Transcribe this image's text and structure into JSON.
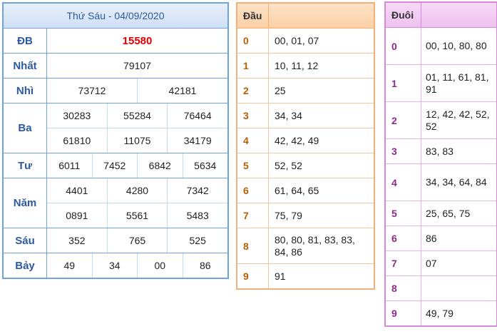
{
  "results": {
    "title": "Thứ Sáu - 04/09/2020",
    "prizes": [
      {
        "label": "ĐB",
        "lines": [
          [
            "15580"
          ]
        ]
      },
      {
        "label": "Nhất",
        "lines": [
          [
            "79107"
          ]
        ]
      },
      {
        "label": "Nhì",
        "lines": [
          [
            "73712",
            "42181"
          ]
        ]
      },
      {
        "label": "Ba",
        "lines": [
          [
            "30283",
            "55284",
            "76464"
          ],
          [
            "61810",
            "11075",
            "34179"
          ]
        ]
      },
      {
        "label": "Tư",
        "lines": [
          [
            "6011",
            "7452",
            "6842",
            "5634"
          ]
        ]
      },
      {
        "label": "Năm",
        "lines": [
          [
            "4401",
            "4280",
            "7342"
          ],
          [
            "0891",
            "5561",
            "5483"
          ]
        ]
      },
      {
        "label": "Sáu",
        "lines": [
          [
            "352",
            "765",
            "525"
          ]
        ]
      },
      {
        "label": "Bảy",
        "lines": [
          [
            "49",
            "34",
            "00",
            "86"
          ]
        ]
      }
    ],
    "special_color": "#e00000"
  },
  "dau": {
    "header": "Đầu",
    "rows": [
      {
        "key": "0",
        "value": "00, 01, 07"
      },
      {
        "key": "1",
        "value": "10, 11, 12"
      },
      {
        "key": "2",
        "value": "25"
      },
      {
        "key": "3",
        "value": "34, 34"
      },
      {
        "key": "4",
        "value": "42, 42, 49"
      },
      {
        "key": "5",
        "value": "52, 52"
      },
      {
        "key": "6",
        "value": "61, 64, 65"
      },
      {
        "key": "7",
        "value": "75, 79"
      },
      {
        "key": "8",
        "value": "80, 80, 81, 83, 83, 84, 86"
      },
      {
        "key": "9",
        "value": "91"
      }
    ]
  },
  "duoi": {
    "header": "Đuôi",
    "rows": [
      {
        "key": "0",
        "value": "00, 10, 80, 80"
      },
      {
        "key": "1",
        "value": "01, 11, 61, 81, 91"
      },
      {
        "key": "2",
        "value": "12, 42, 42, 52, 52"
      },
      {
        "key": "3",
        "value": "83, 83"
      },
      {
        "key": "4",
        "value": "34, 34, 64, 84"
      },
      {
        "key": "5",
        "value": "25, 65, 75"
      },
      {
        "key": "6",
        "value": "86"
      },
      {
        "key": "7",
        "value": "07"
      },
      {
        "key": "8",
        "value": ""
      },
      {
        "key": "9",
        "value": "49, 79"
      }
    ]
  }
}
